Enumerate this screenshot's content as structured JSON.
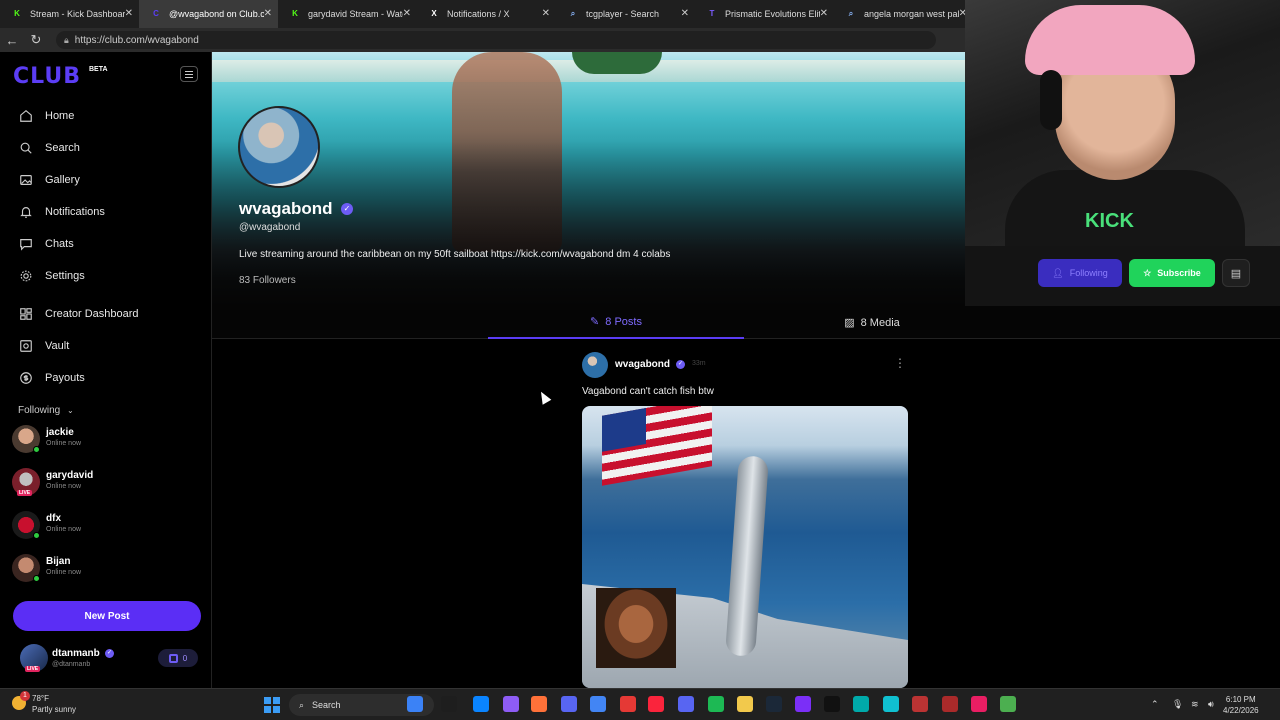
{
  "browser": {
    "tabs": [
      {
        "label": "Stream - Kick Dashboard",
        "favicon": "K",
        "color": "#53fc18",
        "active": false
      },
      {
        "label": "@wvagabond on Club.com",
        "favicon": "C",
        "color": "#5b3df5",
        "active": true
      },
      {
        "label": "garydavid Stream - Watch Li",
        "favicon": "K",
        "color": "#53fc18",
        "active": false
      },
      {
        "label": "Notifications / X",
        "favicon": "X",
        "color": "#ffffff",
        "active": false
      },
      {
        "label": "tcgplayer - Search",
        "favicon": "⌕",
        "color": "#8ab4f8",
        "active": false
      },
      {
        "label": "Prismatic Evolutions Elite Tra",
        "favicon": "T",
        "color": "#7b5cff",
        "active": false
      },
      {
        "label": "angela morgan west pal",
        "favicon": "⌕",
        "color": "#8ab4f8",
        "active": false
      }
    ],
    "url": "https://club.com/wvagabond"
  },
  "sidebar": {
    "logo": "CLUB",
    "logo_badge": "BETA",
    "nav": [
      {
        "label": "Home",
        "icon": "home-icon"
      },
      {
        "label": "Search",
        "icon": "search-icon"
      },
      {
        "label": "Gallery",
        "icon": "gallery-icon"
      },
      {
        "label": "Notifications",
        "icon": "bell-icon"
      },
      {
        "label": "Chats",
        "icon": "chat-icon"
      },
      {
        "label": "Settings",
        "icon": "gear-icon"
      },
      {
        "label": "Creator Dashboard",
        "icon": "dashboard-icon"
      },
      {
        "label": "Vault",
        "icon": "vault-icon"
      },
      {
        "label": "Payouts",
        "icon": "dollar-icon"
      }
    ],
    "following_label": "Following",
    "following": [
      {
        "name": "jackie",
        "status": "Online now",
        "live": false
      },
      {
        "name": "garydavid",
        "status": "Online now",
        "live": true
      },
      {
        "name": "dfx",
        "status": "Online now",
        "live": false
      },
      {
        "name": "Bijan",
        "status": "Online now",
        "live": false
      }
    ],
    "new_post": "New Post",
    "me": {
      "name": "dtanmanb",
      "handle": "@dtanmanb",
      "live": "LIVE",
      "coins": "0"
    }
  },
  "profile": {
    "name": "wvagabond",
    "handle": "@wvagabond",
    "bio": "Live streaming around the caribbean on my 50ft sailboat https://kick.com/wvagabond dm 4 colabs",
    "followers": "83 Followers",
    "following_btn": "Following",
    "subscribe_btn": "Subscribe"
  },
  "tabs": {
    "posts": "8 Posts",
    "media": "8 Media"
  },
  "post": {
    "author": "wvagabond",
    "time": "33m",
    "text": "Vagabond can't catch fish btw"
  },
  "webcam": {
    "hoodie_text": "KICK"
  },
  "taskbar": {
    "weather_temp": "78°F",
    "weather_desc": "Partly sunny",
    "weather_badge": "1",
    "search": "Search",
    "time": "6:10 PM",
    "date": "4/22/2026"
  }
}
